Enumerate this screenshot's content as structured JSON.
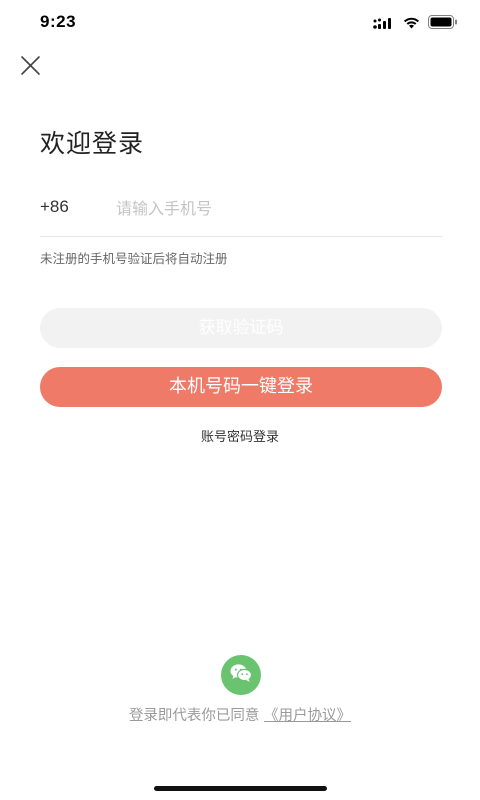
{
  "status_bar": {
    "time": "9:23",
    "icons": [
      "cellular-signal-icon",
      "wifi-icon",
      "battery-icon"
    ]
  },
  "close_icon": "close-icon",
  "welcome_title": "欢迎登录",
  "phone": {
    "country_code": "+86",
    "placeholder": "请输入手机号",
    "value": ""
  },
  "hint": "未注册的手机号验证后将自动注册",
  "get_code_button": "获取验证码",
  "one_key_login_button": "本机号码一键登录",
  "password_login_link": "账号密码登录",
  "wechat_icon": "wechat-icon",
  "agreement": {
    "prefix": "登录即代表你已同意",
    "link": "《用户协议》"
  },
  "colors": {
    "accent": "#ef7a67",
    "disabled_button": "#f2f2f2",
    "wechat": "#6ac36f",
    "placeholder": "#c4c4c4"
  }
}
